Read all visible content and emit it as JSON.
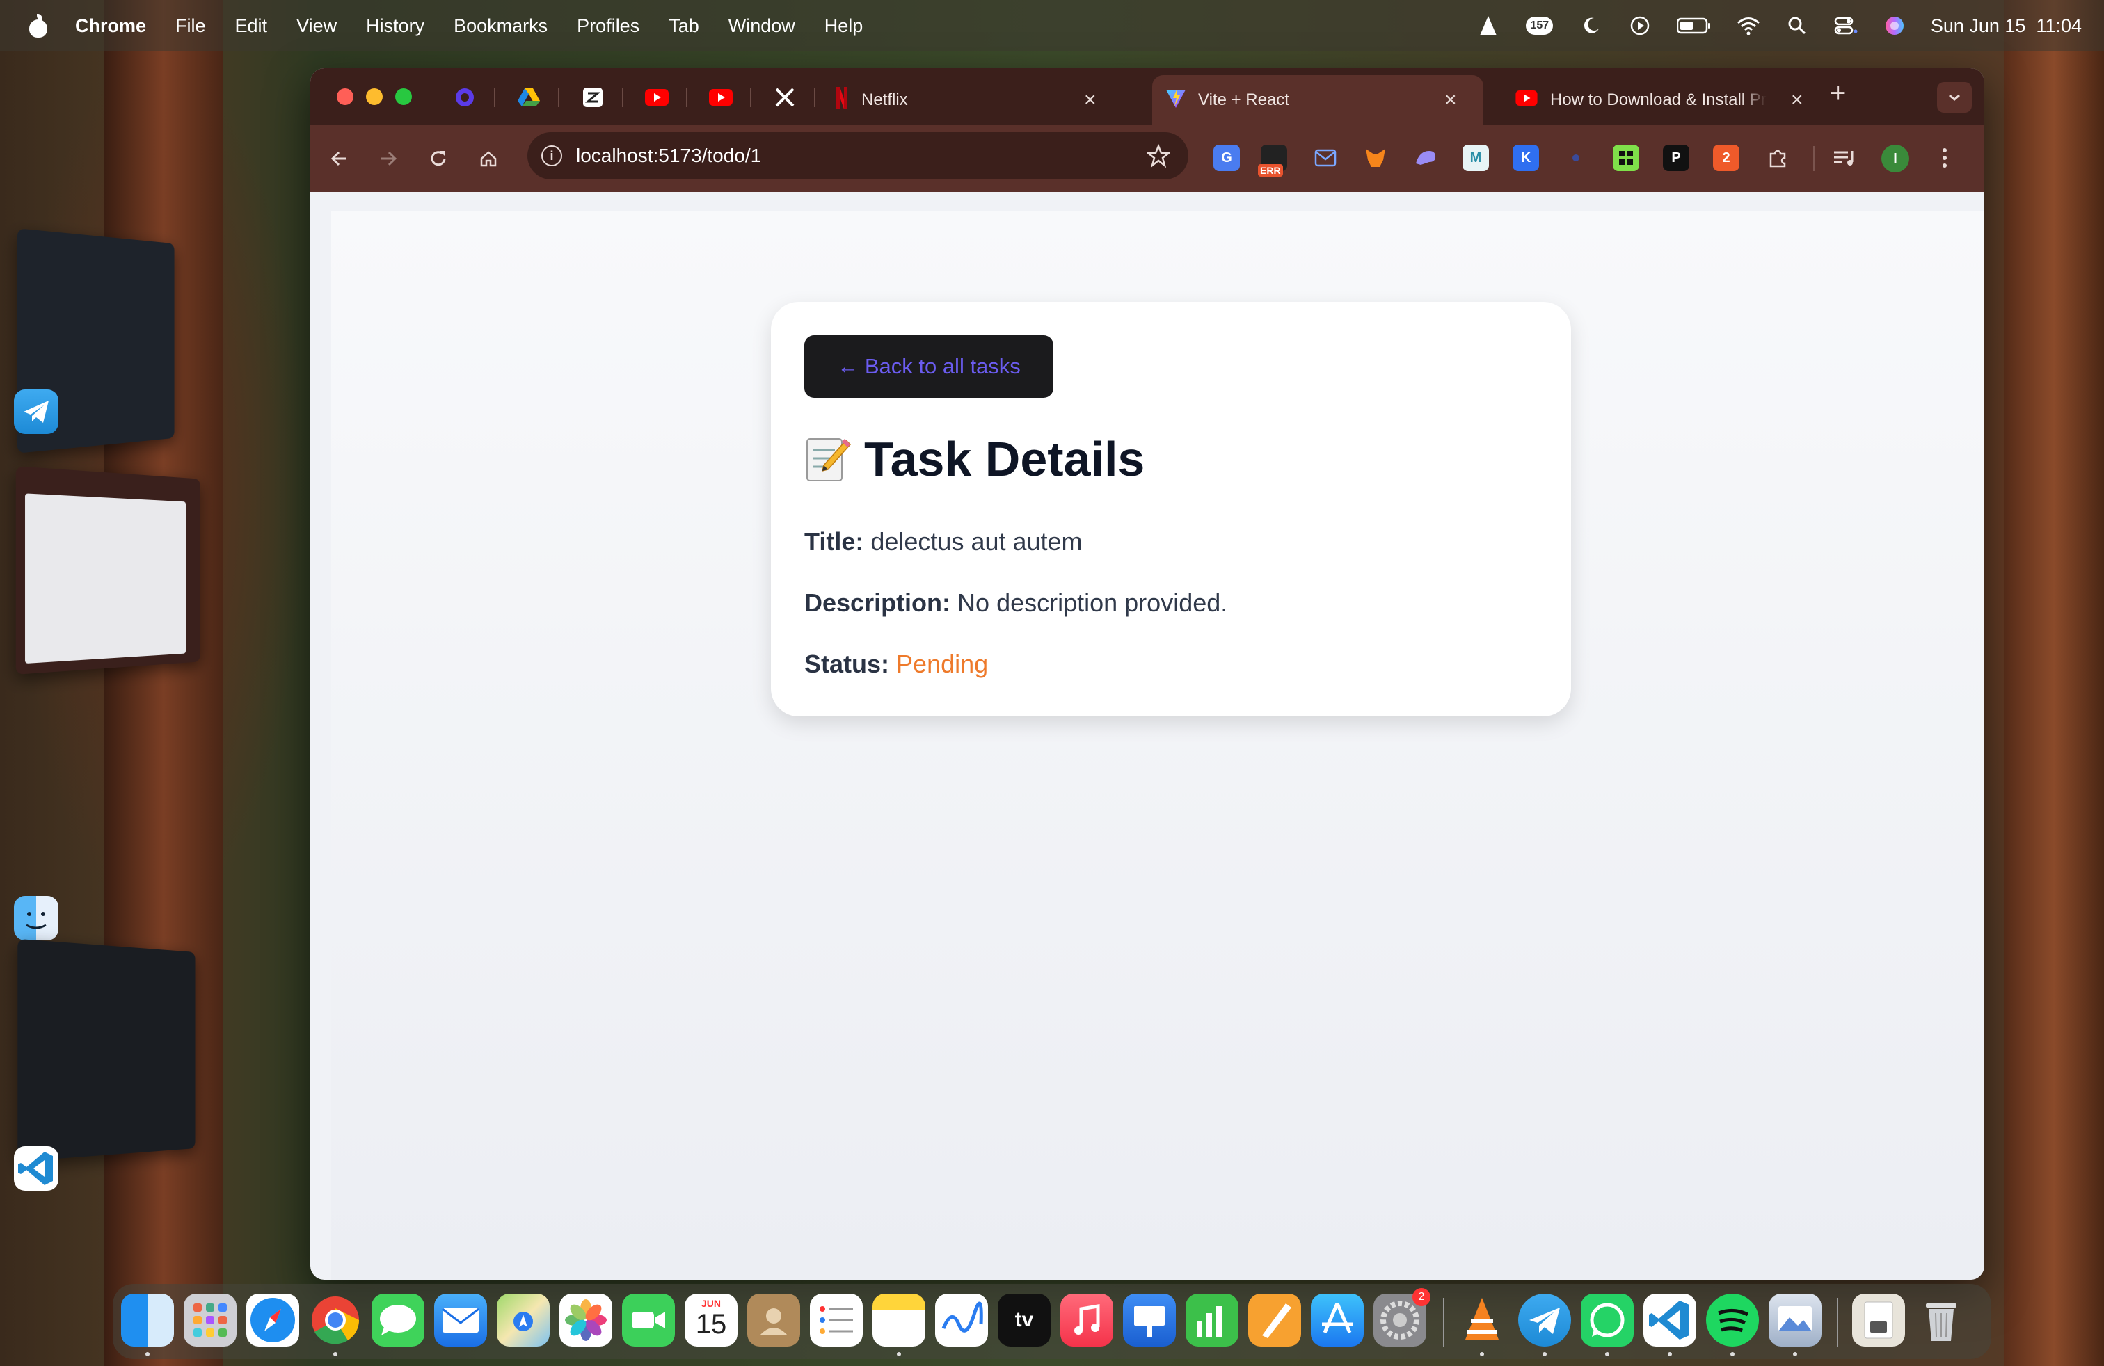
{
  "menubar": {
    "app_name": "Chrome",
    "items": [
      "File",
      "Edit",
      "View",
      "History",
      "Bookmarks",
      "Profiles",
      "Tab",
      "Window",
      "Help"
    ],
    "notification_count": "157",
    "datetime": "Sun Jun 15  11:04"
  },
  "browser": {
    "tabs": [
      {
        "label": "Netflix",
        "icon": "netflix-icon"
      },
      {
        "label": "Vite + React",
        "icon": "vite-icon",
        "active": true
      },
      {
        "label": "How to Download & Install Pr",
        "icon": "youtube-icon"
      }
    ],
    "url": "localhost:5173/todo/1",
    "err_badge": "ERR",
    "profile_initial": "I"
  },
  "page": {
    "back_label": "← Back to all tasks",
    "heading": "Task Details",
    "title_label": "Title:",
    "title_value": "delectus aut autem",
    "description_label": "Description:",
    "description_value": "No description provided.",
    "status_label": "Status:",
    "status_value": "Pending",
    "status_color": "#ee7a2b"
  },
  "dock": {
    "calendar_month": "JUN",
    "calendar_day": "15",
    "settings_badge": "2",
    "tv_label": "tv"
  }
}
